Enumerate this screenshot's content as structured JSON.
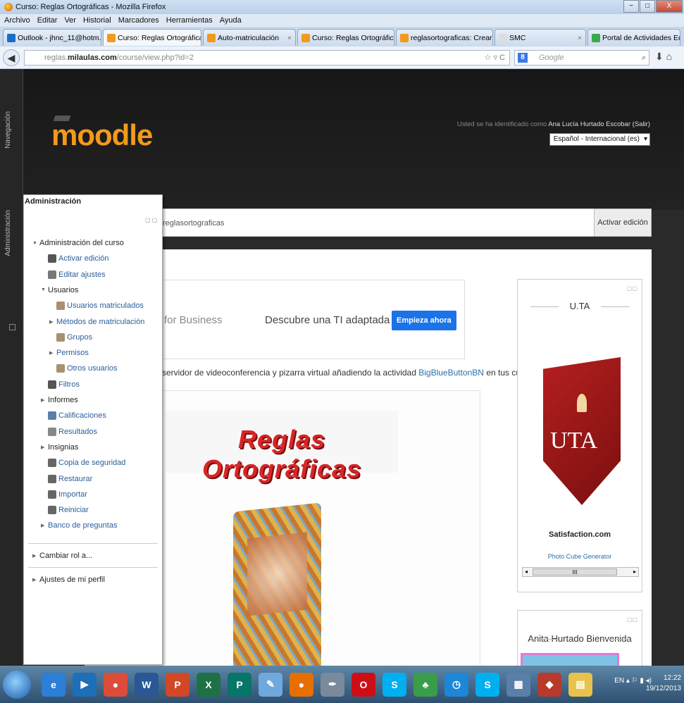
{
  "window": {
    "title": "Curso: Reglas Ortográficas - Mozilla Firefox",
    "buttons": [
      "−",
      "□",
      "X"
    ]
  },
  "menu": [
    "Archivo",
    "Editar",
    "Ver",
    "Historial",
    "Marcadores",
    "Herramientas",
    "Ayuda"
  ],
  "tabs": [
    {
      "label": "Outlook - jhnc_11@hotm...",
      "color": "#1a6fc4"
    },
    {
      "label": "Curso: Reglas Ortográficas",
      "color": "#f29a1c",
      "active": true
    },
    {
      "label": "Auto-matriculación",
      "color": "#f29a1c"
    },
    {
      "label": "Curso: Reglas Ortográficas",
      "color": "#f29a1c"
    },
    {
      "label": "reglasortograficas: Crear D...",
      "color": "#f29a1c"
    },
    {
      "label": "SMC",
      "color": "#dddddd"
    },
    {
      "label": "Portal de Actividades Edu...",
      "color": "#3aa84c"
    }
  ],
  "nav": {
    "url_domain": "reglas.milaulas.com",
    "url_path": "/course/view.php?id=2",
    "url_prefix": "reglas.",
    "url_main": "milaulas.com",
    "reload": "☆ ▿ C",
    "search_placeholder": "Google",
    "search_engine": "8"
  },
  "sidebar_tabs": {
    "nav": "Navegación",
    "admin": "Administración"
  },
  "header": {
    "logo": "moodle",
    "login_prefix": "Usted se ha identificado como",
    "user": "Ana Lucía Hurtado Escobar",
    "logout": "(Salir)",
    "language": "Español - Internacional (es)"
  },
  "breadcrumb": "reglasortograficas",
  "edit_button": "Activar edición",
  "ad": {
    "left": "ps for Business",
    "mid": "Descubre una TI adaptada a ti",
    "button": "Empieza ahora"
  },
  "info": {
    "text": "o servidor de videoconferencia y pizarra virtual añadiendo la actividad",
    "link": "BigBlueButtonBN",
    "tail": "en tus cursos."
  },
  "banner": "Reglas Ortográficas",
  "uta_block": {
    "title": "U.TA",
    "logo_text": "UTA",
    "caption": "Satisfaction.com",
    "link": "Photo Cube Generator",
    "scroll_thumb": "III"
  },
  "welcome_block": {
    "title": "Anita Hurtado Bienvenida"
  },
  "admin": {
    "title": "Administración",
    "items": [
      {
        "label": "Administración del curso",
        "arrow": "▼",
        "indent": 0,
        "icon": "none",
        "link": false
      },
      {
        "label": "Activar edición",
        "arrow": "",
        "indent": 1,
        "icon": "pencil-icon",
        "link": true
      },
      {
        "label": "Editar ajustes",
        "arrow": "",
        "indent": 1,
        "icon": "gear-icon",
        "link": true
      },
      {
        "label": "Usuarios",
        "arrow": "▼",
        "indent": 1,
        "icon": "none",
        "link": false
      },
      {
        "label": "Usuarios matriculados",
        "arrow": "",
        "indent": 2,
        "icon": "user-icon",
        "link": true
      },
      {
        "label": "Métodos de matriculación",
        "arrow": "▶",
        "indent": 2,
        "icon": "none",
        "link": true
      },
      {
        "label": "Grupos",
        "arrow": "",
        "indent": 2,
        "icon": "users-icon",
        "link": true
      },
      {
        "label": "Permisos",
        "arrow": "▶",
        "indent": 2,
        "icon": "none",
        "link": true
      },
      {
        "label": "Otros usuarios",
        "arrow": "",
        "indent": 2,
        "icon": "user-icon",
        "link": true
      },
      {
        "label": "Filtros",
        "arrow": "",
        "indent": 1,
        "icon": "filter-icon",
        "link": true
      },
      {
        "label": "Informes",
        "arrow": "▶",
        "indent": 1,
        "icon": "none",
        "link": false
      },
      {
        "label": "Calificaciones",
        "arrow": "",
        "indent": 1,
        "icon": "grades-icon",
        "link": true
      },
      {
        "label": "Resultados",
        "arrow": "",
        "indent": 1,
        "icon": "outcomes-icon",
        "link": true
      },
      {
        "label": "Insignias",
        "arrow": "▶",
        "indent": 1,
        "icon": "none",
        "link": false
      },
      {
        "label": "Copia de seguridad",
        "arrow": "",
        "indent": 1,
        "icon": "backup-icon",
        "link": true
      },
      {
        "label": "Restaurar",
        "arrow": "",
        "indent": 1,
        "icon": "restore-icon",
        "link": true
      },
      {
        "label": "Importar",
        "arrow": "",
        "indent": 1,
        "icon": "import-icon",
        "link": true
      },
      {
        "label": "Reiniciar",
        "arrow": "",
        "indent": 1,
        "icon": "reset-icon",
        "link": true
      },
      {
        "label": "Banco de preguntas",
        "arrow": "▶",
        "indent": 1,
        "icon": "none",
        "link": true
      }
    ],
    "change_role": "Cambiar rol a...",
    "profile": "Ajustes de mi perfil"
  },
  "taskbar": {
    "apps": [
      {
        "name": "ie-icon",
        "color": "#2b7fd6",
        "text": "e"
      },
      {
        "name": "media-icon",
        "color": "#1d6fb8",
        "text": "▶"
      },
      {
        "name": "chrome-icon",
        "color": "#dd4b39",
        "text": "●"
      },
      {
        "name": "word-icon",
        "color": "#2b5797",
        "text": "W"
      },
      {
        "name": "powerpoint-icon",
        "color": "#d24726",
        "text": "P"
      },
      {
        "name": "excel-icon",
        "color": "#1e7145",
        "text": "X"
      },
      {
        "name": "publisher-icon",
        "color": "#077568",
        "text": "P"
      },
      {
        "name": "paint-icon",
        "color": "#6fa8dc",
        "text": "✎"
      },
      {
        "name": "firefox-icon",
        "color": "#e76f00",
        "text": "●"
      },
      {
        "name": "tool-icon",
        "color": "#7a8a9a",
        "text": "✒"
      },
      {
        "name": "opera-icon",
        "color": "#cc0f16",
        "text": "O"
      },
      {
        "name": "skype-icon",
        "color": "#00aff0",
        "text": "S"
      },
      {
        "name": "messenger-icon",
        "color": "#3a9d4a",
        "text": "♣"
      },
      {
        "name": "clock-app-icon",
        "color": "#1c86d8",
        "text": "◷"
      },
      {
        "name": "skype2-icon",
        "color": "#00aff0",
        "text": "S"
      },
      {
        "name": "calculator-icon",
        "color": "#5a7fa8",
        "text": "▦"
      },
      {
        "name": "cube-icon",
        "color": "#b83a2a",
        "text": "◆"
      },
      {
        "name": "folder-icon",
        "color": "#e8c24a",
        "text": "▤"
      }
    ],
    "tray": "EN  ▴  ⚐ ▮ ◂)",
    "time": "12:22",
    "date": "19/12/2013"
  }
}
